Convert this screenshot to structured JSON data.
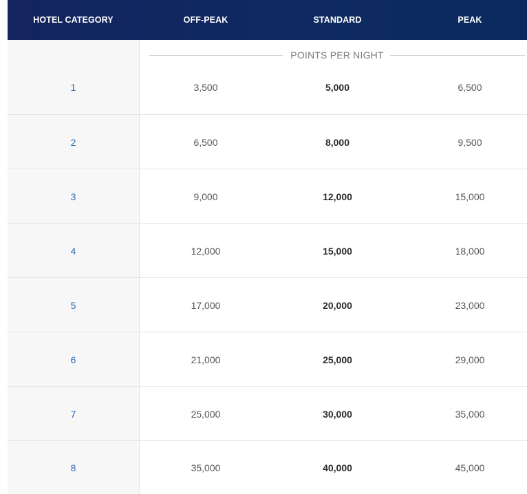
{
  "header": {
    "category": "HOTEL CATEGORY",
    "off_peak": "OFF-PEAK",
    "standard": "STANDARD",
    "peak": "PEAK"
  },
  "subheader": "POINTS PER NIGHT",
  "rows": [
    {
      "category": "1",
      "off_peak": "3,500",
      "standard": "5,000",
      "peak": "6,500"
    },
    {
      "category": "2",
      "off_peak": "6,500",
      "standard": "8,000",
      "peak": "9,500"
    },
    {
      "category": "3",
      "off_peak": "9,000",
      "standard": "12,000",
      "peak": "15,000"
    },
    {
      "category": "4",
      "off_peak": "12,000",
      "standard": "15,000",
      "peak": "18,000"
    },
    {
      "category": "5",
      "off_peak": "17,000",
      "standard": "20,000",
      "peak": "23,000"
    },
    {
      "category": "6",
      "off_peak": "21,000",
      "standard": "25,000",
      "peak": "29,000"
    },
    {
      "category": "7",
      "off_peak": "25,000",
      "standard": "30,000",
      "peak": "35,000"
    },
    {
      "category": "8",
      "off_peak": "35,000",
      "standard": "40,000",
      "peak": "45,000"
    }
  ],
  "colors": {
    "header_bg": "#13245f",
    "category_link": "#2a6db4"
  }
}
